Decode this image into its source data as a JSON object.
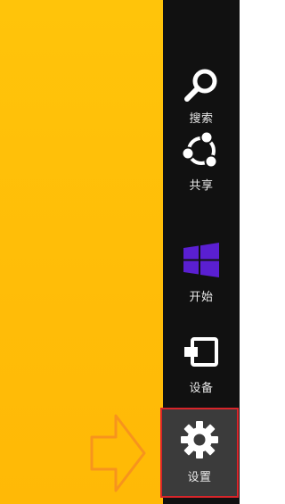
{
  "charms": {
    "search": {
      "label": "搜索",
      "icon": "search-icon"
    },
    "share": {
      "label": "共享",
      "icon": "share-icon"
    },
    "start": {
      "label": "开始",
      "icon": "windows-logo-icon"
    },
    "devices": {
      "label": "设备",
      "icon": "devices-icon"
    },
    "settings": {
      "label": "设置",
      "icon": "gear-icon",
      "highlighted": true
    }
  },
  "colors": {
    "desktop_background": "#ffc40a",
    "charms_bar": "#111111",
    "highlight_border": "#d8252a",
    "windows_logo": "#5a1fd1",
    "pointer_arrow": "#f7941d"
  }
}
